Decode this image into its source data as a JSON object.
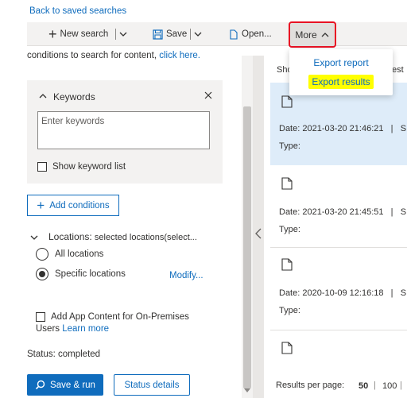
{
  "back_link": "Back to saved searches",
  "toolbar": {
    "new_search": "New search",
    "save": "Save",
    "open": "Open...",
    "more": "More"
  },
  "more_menu": {
    "items": [
      "Export report",
      "Export results"
    ]
  },
  "left": {
    "cut_text": "conditions to search for content, ",
    "cut_link": "click here.",
    "keywords_title": "Keywords",
    "keywords_placeholder": "Enter keywords",
    "show_keyword_list": "Show keyword list",
    "add_conditions": "Add conditions",
    "locations_label": "Locations:",
    "locations_value": "selected locations(select...",
    "all_locations": "All locations",
    "specific_locations": "Specific locations",
    "modify": "Modify...",
    "app_content": "Add App Content for On-Premises",
    "users": "Users",
    "learn_more": "Learn more",
    "status": "Status: completed",
    "save_run": "Save & run",
    "status_details": "Status details"
  },
  "results": {
    "header_left": "Sho",
    "header_right": "est",
    "items": [
      {
        "date": "Date: 2021-03-20 21:46:21",
        "type": "Type:"
      },
      {
        "date": "Date: 2021-03-20 21:45:51",
        "type": "Type:"
      },
      {
        "date": "Date: 2020-10-09 12:16:18",
        "type": "Type:"
      }
    ],
    "pipe": "|",
    "trail": "S",
    "per_page_label": "Results per page:",
    "per_page_50": "50",
    "per_page_100": "100"
  },
  "colors": {
    "accent": "#0f6cbd",
    "highlight": "#ffff00",
    "annotation_red": "#e81123",
    "selected_row": "#deecf9"
  }
}
